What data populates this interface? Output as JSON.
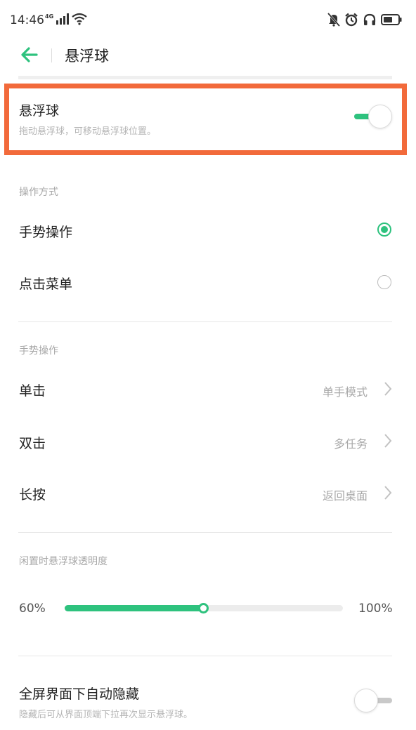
{
  "colors": {
    "accent": "#2ec27e",
    "highlight": "#f26a3b"
  },
  "status_bar": {
    "time": "14:46",
    "network": "4G",
    "icons": [
      "signal-icon",
      "wifi-icon",
      "mute-icon",
      "alarm-icon",
      "headset-icon",
      "battery-icon"
    ]
  },
  "header": {
    "title": "悬浮球",
    "back_icon": "back-arrow-icon"
  },
  "floating_ball": {
    "title": "悬浮球",
    "subtitle": "拖动悬浮球，可移动悬浮球位置。",
    "enabled": true
  },
  "operation_mode": {
    "section_label": "操作方式",
    "options": [
      {
        "label": "手势操作",
        "selected": true
      },
      {
        "label": "点击菜单",
        "selected": false
      }
    ]
  },
  "gestures": {
    "section_label": "手势操作",
    "items": [
      {
        "label": "单击",
        "value": "单手模式"
      },
      {
        "label": "双击",
        "value": "多任务"
      },
      {
        "label": "长按",
        "value": "返回桌面"
      }
    ]
  },
  "opacity": {
    "section_label": "闲置时悬浮球透明度",
    "min_label": "60%",
    "max_label": "100%",
    "level_fraction": 0.5
  },
  "auto_hide": {
    "title": "全屏界面下自动隐藏",
    "subtitle": "隐藏后可从界面顶端下拉再次显示悬浮球。",
    "enabled": false
  }
}
